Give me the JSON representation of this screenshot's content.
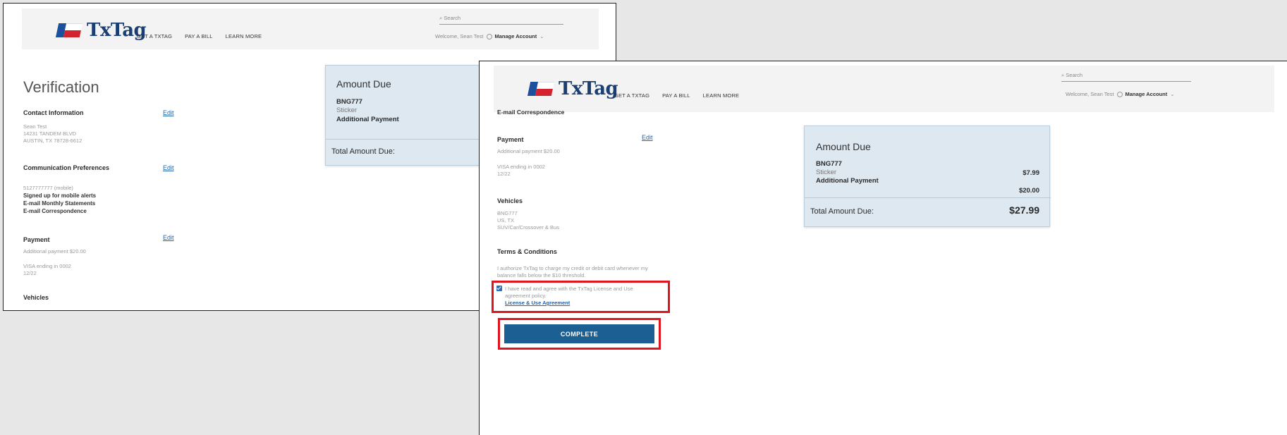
{
  "brand": {
    "name": "TxTag"
  },
  "nav": {
    "items": [
      "GET A TXTAG",
      "PAY A BILL",
      "LEARN MORE"
    ]
  },
  "header": {
    "search_placeholder": "Search",
    "welcome": "Welcome, Sean Test",
    "manage_account": "Manage Account"
  },
  "back_page": {
    "title": "Verification",
    "contact": {
      "heading": "Contact Information",
      "edit": "Edit",
      "lines": [
        "Sean Test",
        "14231 TANDEM BLVD",
        "AUSTIN, TX 78728-6612"
      ]
    },
    "comm": {
      "heading": "Communication Preferences",
      "edit": "Edit",
      "phone": "5127777777 (mobile)",
      "items": [
        "Signed up for mobile alerts",
        "E-mail Monthly Statements",
        "E-mail Correspondence"
      ]
    },
    "payment": {
      "heading": "Payment",
      "edit": "Edit",
      "additional": "Additional payment $20.00",
      "card": "VISA ending in 0002",
      "exp": "12/22"
    },
    "vehicles_heading": "Vehicles",
    "amount": {
      "title": "Amount Due",
      "plate": "BNG777",
      "sticker": "Sticker",
      "additional": "Additional Payment",
      "total_label": "Total Amount Due:"
    }
  },
  "front_page": {
    "email_corr": "E-mail Correspondence",
    "payment": {
      "heading": "Payment",
      "edit": "Edit",
      "additional": "Additional payment $20.00",
      "card": "VISA ending in 0002",
      "exp": "12/22"
    },
    "vehicles": {
      "heading": "Vehicles",
      "lines": [
        "BNG777",
        "US, TX",
        "SUV/Car/Crossover & Bus"
      ]
    },
    "terms": {
      "heading": "Terms & Conditions",
      "authorize": [
        "I authorize TxTag to charge my credit or debit card whenever my",
        "balance falls below the $10 threshold."
      ],
      "agree": [
        "I have read and agree with the TxTag License and Use",
        "agreement policy."
      ],
      "link": "License & Use Agreement",
      "checked": true
    },
    "complete_button": "COMPLETE",
    "amount": {
      "title": "Amount Due",
      "plate": "BNG777",
      "sticker": "Sticker",
      "sticker_amount": "$7.99",
      "additional": "Additional Payment",
      "additional_amount": "$20.00",
      "total_label": "Total Amount Due:",
      "total_amount": "$27.99"
    }
  },
  "colors": {
    "highlight": "#e0151d",
    "button": "#1b5f93",
    "link": "#1f63a8",
    "amount_bg": "#dde8f1"
  }
}
